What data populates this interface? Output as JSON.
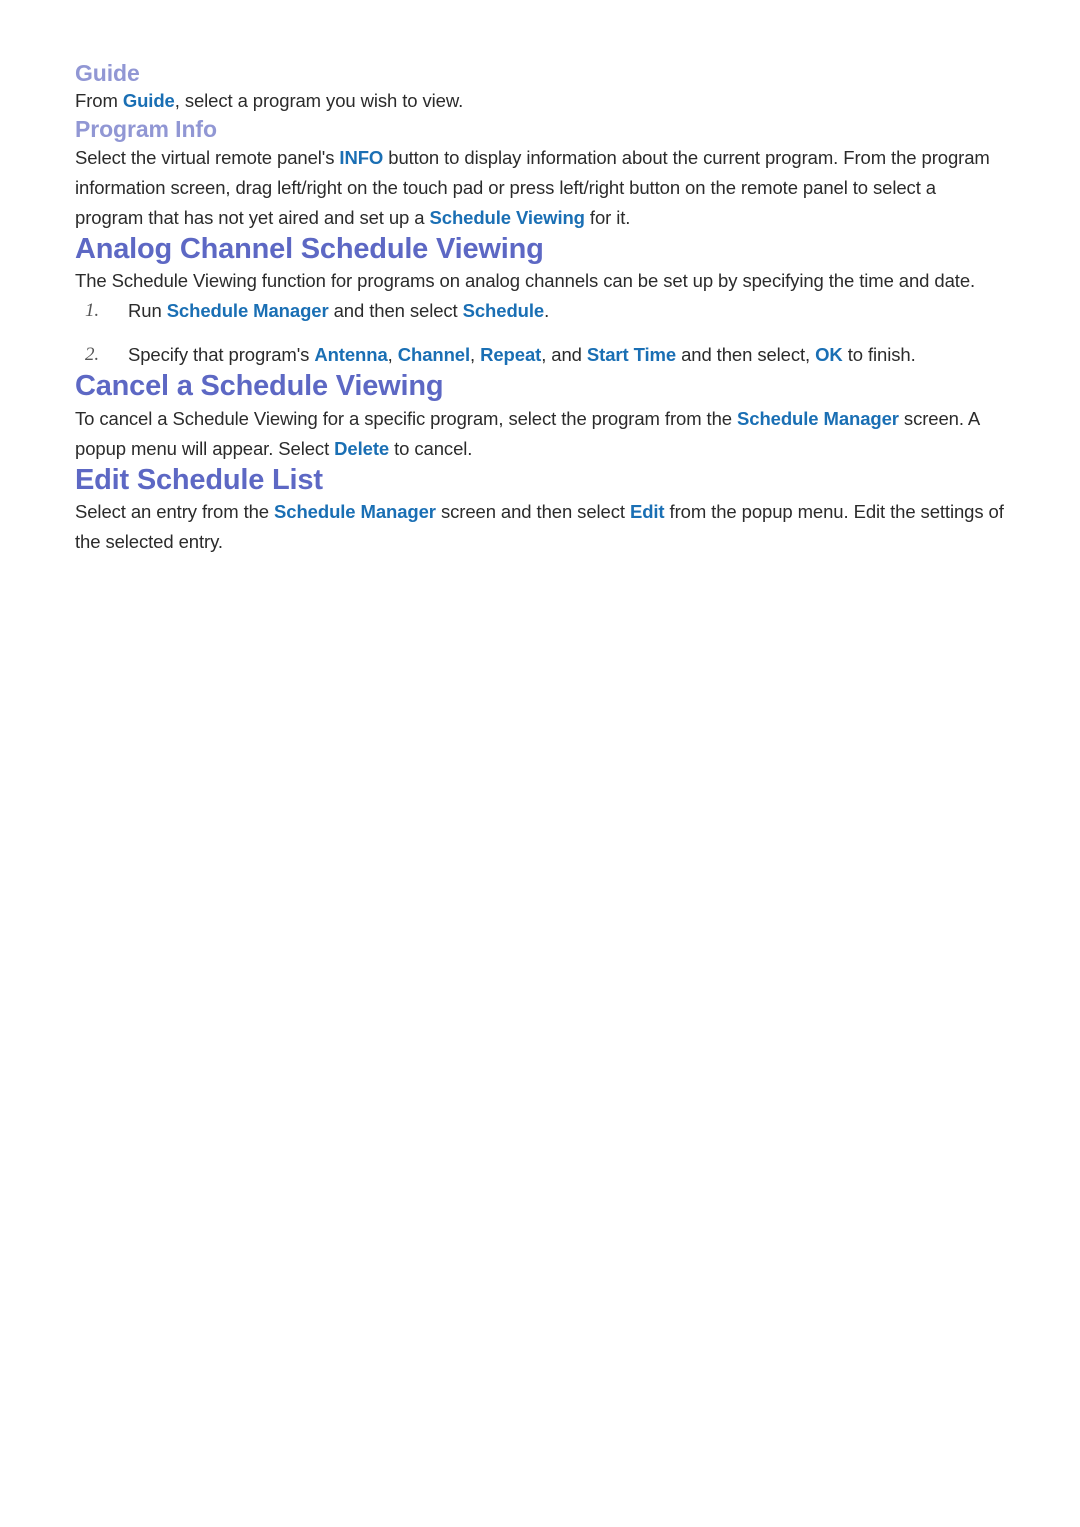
{
  "colors": {
    "section_heading": "#5d68c4",
    "sub_heading": "#9197d4",
    "link": "#1a6fb4",
    "body": "#2b2b2b",
    "page_background": "#ffffff"
  },
  "sections": {
    "guide": {
      "heading": "Guide",
      "paragraph": {
        "part1": "From ",
        "link1": "Guide",
        "part2": ", select a program you wish to view."
      }
    },
    "program_info": {
      "heading": "Program Info",
      "paragraph": {
        "part1": "Select the virtual remote panel's ",
        "link1": "INFO",
        "part2": " button to display information about the current program. From the program information screen, drag left/right on the touch pad or press left/right button on the remote panel to select a program that has not yet aired and set up a ",
        "link2": "Schedule Viewing",
        "part3": " for it."
      }
    },
    "analog_channel_schedule_viewing": {
      "heading": "Analog Channel Schedule Viewing",
      "paragraph": "The Schedule Viewing function for programs on analog channels can be set up by specifying the time and date.",
      "steps": [
        {
          "number": "1.",
          "part1": "Run ",
          "link1": "Schedule Manager",
          "part2": " and then select ",
          "link2": "Schedule",
          "part3": "."
        },
        {
          "number": "2.",
          "part1": "Specify that program's ",
          "link1": "Antenna",
          "part2": ", ",
          "link2": "Channel",
          "part3": ", ",
          "link3": "Repeat",
          "part4": ", and ",
          "link4": "Start Time",
          "part5": " and then select, ",
          "link5": "OK",
          "part6": " to finish."
        }
      ]
    },
    "cancel_a_schedule_viewing": {
      "heading": "Cancel a Schedule Viewing",
      "paragraph": {
        "part1": "To cancel a Schedule Viewing for a specific program, select the program from the ",
        "link1": "Schedule Manager",
        "part2": " screen. A popup menu will appear. Select ",
        "link2": "Delete",
        "part3": " to cancel."
      }
    },
    "edit_schedule_list": {
      "heading": "Edit Schedule List",
      "paragraph": {
        "part1": "Select an entry from the ",
        "link1": "Schedule Manager",
        "part2": " screen and then select ",
        "link2": "Edit",
        "part3": " from the popup menu. Edit the settings of the selected entry."
      }
    }
  }
}
